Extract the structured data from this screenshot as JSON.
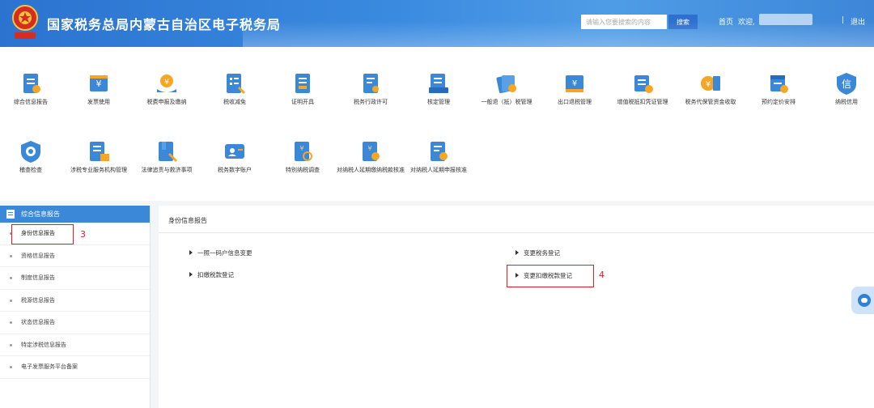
{
  "header": {
    "title": "国家税务总局内蒙古自治区电子税务局",
    "search_placeholder": "请输入您要搜索的内容",
    "search_button": "搜索",
    "home_link": "首页",
    "welcome_label": "欢迎,",
    "logout_link": "退出",
    "separator": "|"
  },
  "icons": [
    {
      "label": "综合信息报告",
      "icon": "report-icon"
    },
    {
      "label": "发票使用",
      "icon": "invoice-icon"
    },
    {
      "label": "税费申报及缴纳",
      "icon": "tax-payment-icon"
    },
    {
      "label": "税收减免",
      "icon": "tax-relief-icon"
    },
    {
      "label": "证明开具",
      "icon": "certificate-icon"
    },
    {
      "label": "税务行政许可",
      "icon": "permit-icon"
    },
    {
      "label": "核定管理",
      "icon": "assessment-icon"
    },
    {
      "label": "一般退（抵）税管理",
      "icon": "refund-icon"
    },
    {
      "label": "出口退税管理",
      "icon": "export-refund-icon"
    },
    {
      "label": "增值税抵扣凭证管理",
      "icon": "vat-voucher-icon"
    },
    {
      "label": "税务代保管资金收取",
      "icon": "custody-fund-icon"
    },
    {
      "label": "预约定价安排",
      "icon": "pricing-icon"
    },
    {
      "label": "纳税信用",
      "icon": "credit-icon"
    },
    {
      "label": "稽查检查",
      "icon": "inspection-icon"
    },
    {
      "label": "涉税专业服务机构管理",
      "icon": "agency-icon"
    },
    {
      "label": "法律追责与救济事项",
      "icon": "legal-icon"
    },
    {
      "label": "税务数字账户",
      "icon": "digital-account-icon"
    },
    {
      "label": "特别纳税调查",
      "icon": "special-investigation-icon"
    },
    {
      "label": "对纳税人延期缴纳税款核准",
      "icon": "deferred-payment-icon"
    },
    {
      "label": "对纳税人延期申报核准",
      "icon": "deferred-filing-icon"
    }
  ],
  "sidebar": {
    "title": "综合信息报告",
    "items": [
      {
        "label": "身份信息报告"
      },
      {
        "label": "资格信息报告"
      },
      {
        "label": "制度信息报告"
      },
      {
        "label": "税源信息报告"
      },
      {
        "label": "状态信息报告"
      },
      {
        "label": "特定涉税信息报告"
      },
      {
        "label": "电子发票服务平台备案"
      }
    ]
  },
  "main": {
    "title": "身份信息报告",
    "links": [
      {
        "label": "一照一码户信息变更"
      },
      {
        "label": "扣缴税款登记"
      },
      {
        "label": "变更税务登记"
      },
      {
        "label": "变更扣缴税款登记"
      }
    ]
  },
  "annotations": {
    "step3": "3",
    "step4": "4"
  },
  "colors": {
    "header_blue": "#3a8ae0",
    "sidebar_head": "#3b88d8",
    "highlight_red": "#e02020"
  }
}
